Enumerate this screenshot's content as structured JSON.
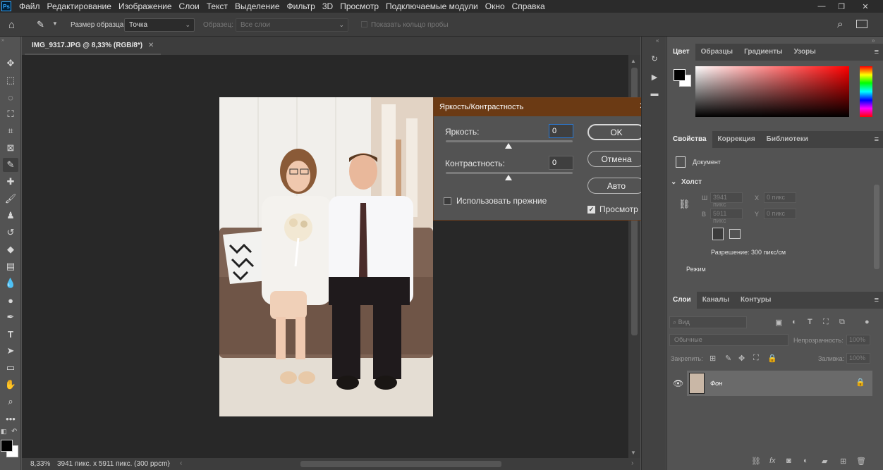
{
  "menubar": {
    "logo": "Ps",
    "items": [
      "Файл",
      "Редактирование",
      "Изображение",
      "Слои",
      "Текст",
      "Выделение",
      "Фильтр",
      "3D",
      "Просмотр",
      "Подключаемые модули",
      "Окно",
      "Справка"
    ],
    "window_controls": [
      "—",
      "❐",
      "✕"
    ]
  },
  "options": {
    "sample_size_label": "Размер образца:",
    "sample_size_value": "Точка",
    "sample_label": "Образец:",
    "sample_value": "Все слои",
    "show_ring_label": "Показать кольцо пробы"
  },
  "document": {
    "tab_title": "IMG_9317.JPG @ 8,33% (RGB/8*)",
    "tab_close": "✕",
    "zoom": "8,33%",
    "size_info": "3941 пикс. x 5911 пикс. (300 ppcm)"
  },
  "dialog": {
    "title": "Яркость/Контрастность",
    "brightness_label": "Яркость:",
    "brightness_value": "0",
    "contrast_label": "Контрастность:",
    "contrast_value": "0",
    "use_legacy_label": "Использовать прежние",
    "use_legacy_checked": false,
    "ok_label": "OK",
    "cancel_label": "Отмена",
    "auto_label": "Авто",
    "preview_label": "Просмотр",
    "preview_checked": true
  },
  "color_panel": {
    "tabs": [
      "Цвет",
      "Образцы",
      "Градиенты",
      "Узоры"
    ],
    "foreground": "#000000",
    "background": "#ffffff"
  },
  "properties_panel": {
    "tabs": [
      "Свойства",
      "Коррекция",
      "Библиотеки"
    ],
    "doc_label": "Документ",
    "canvas_label": "Холст",
    "w_label": "Ш",
    "w_value": "3941 пикс",
    "h_label": "В",
    "h_value": "5911 пикс",
    "x_label": "X",
    "x_value": "0 пикс",
    "y_label": "Y",
    "y_value": "0 пикс",
    "resolution": "Разрешение: 300 пикс/см",
    "mode_label": "Режим"
  },
  "layers_panel": {
    "tabs": [
      "Слои",
      "Каналы",
      "Контуры"
    ],
    "filter_placeholder": "Вид",
    "blend_mode": "Обычные",
    "opacity_label": "Непрозрачность:",
    "opacity_value": "100%",
    "lock_label": "Закрепить:",
    "fill_label": "Заливка:",
    "fill_value": "100%",
    "layer_name": "Фон"
  }
}
